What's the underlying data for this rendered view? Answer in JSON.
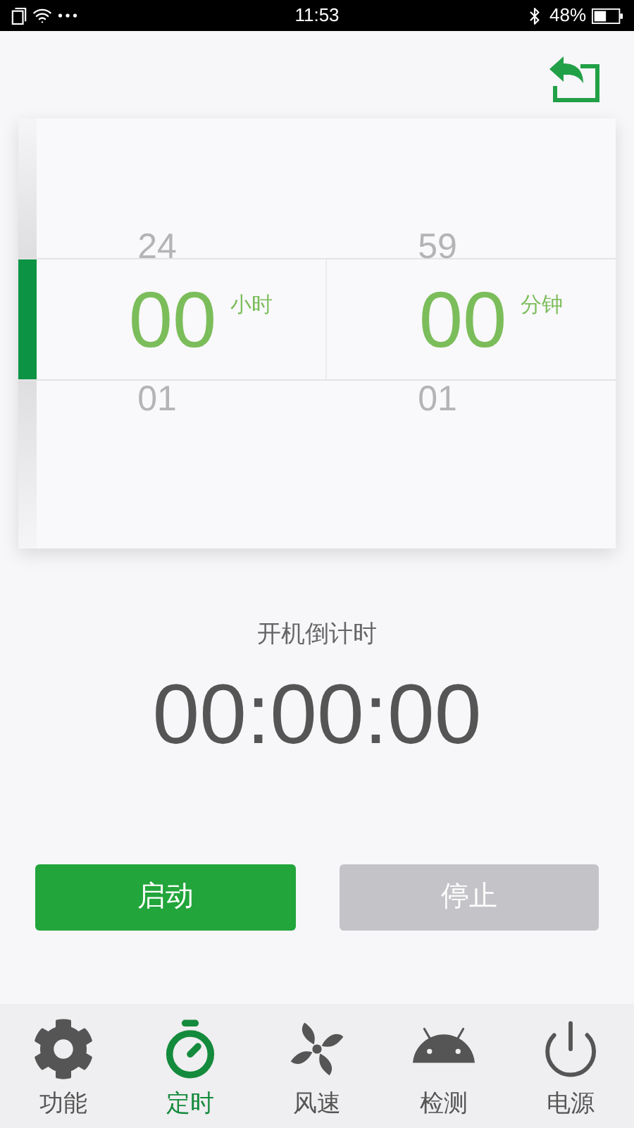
{
  "status_bar": {
    "time": "11:53",
    "battery": "48%"
  },
  "picker": {
    "columns": [
      {
        "above": "24",
        "value": "00",
        "unit": "小时",
        "below": "01"
      },
      {
        "above": "59",
        "value": "00",
        "unit": "分钟",
        "below": "01"
      }
    ]
  },
  "countdown": {
    "label": "开机倒计时",
    "value": "00:00:00"
  },
  "buttons": [
    {
      "label": "启动",
      "disabled": false
    },
    {
      "label": "停止",
      "disabled": true
    }
  ],
  "nav": [
    {
      "label": "功能",
      "kind": "gear",
      "selected": false
    },
    {
      "label": "定时",
      "kind": "timer",
      "selected": true
    },
    {
      "label": "风速",
      "kind": "fan",
      "selected": false
    },
    {
      "label": "检测",
      "kind": "android",
      "selected": false
    },
    {
      "label": "电源",
      "kind": "power",
      "selected": false
    }
  ]
}
